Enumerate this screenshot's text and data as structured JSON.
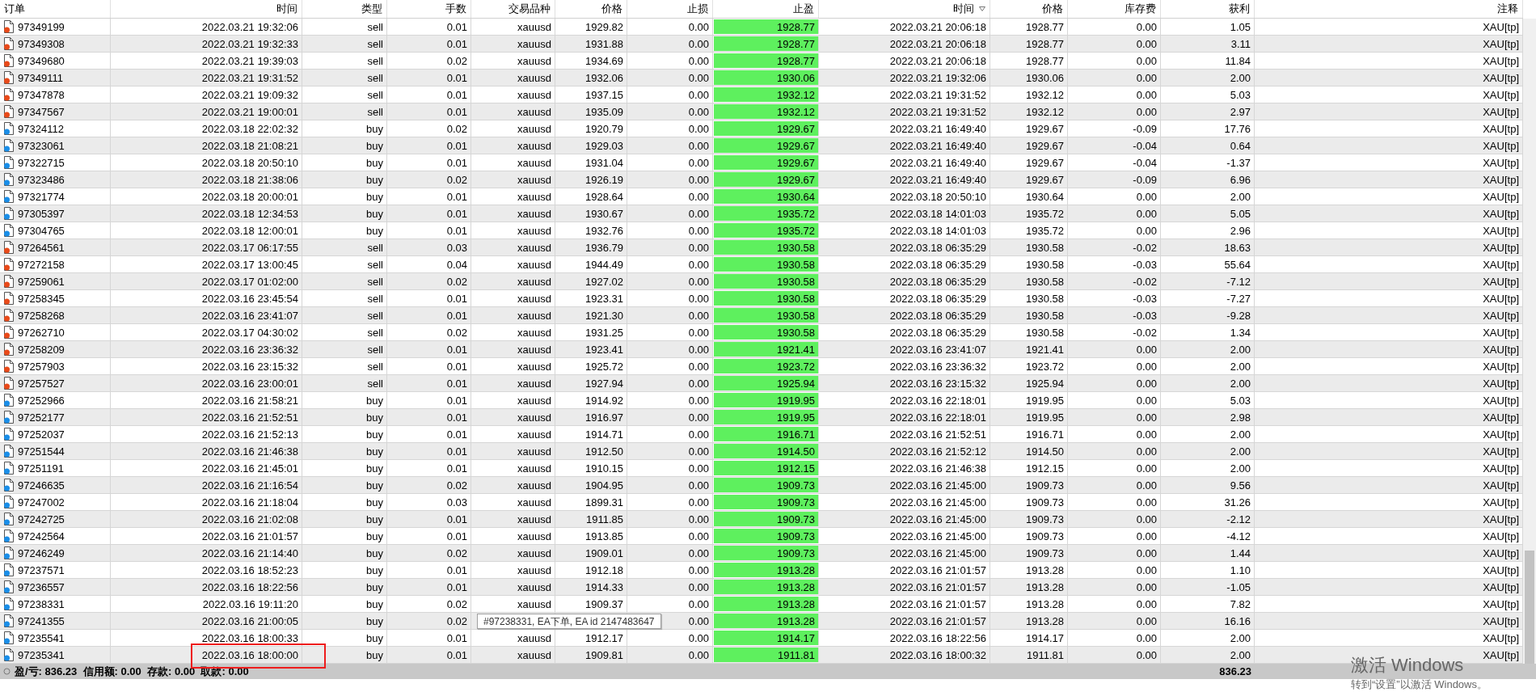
{
  "table": {
    "columns": [
      {
        "label": "订单"
      },
      {
        "label": "时间"
      },
      {
        "label": "类型"
      },
      {
        "label": "手数"
      },
      {
        "label": "交易品种"
      },
      {
        "label": "价格"
      },
      {
        "label": "止损"
      },
      {
        "label": "止盈"
      },
      {
        "label": "时间",
        "sorted": true
      },
      {
        "label": "价格"
      },
      {
        "label": "库存费"
      },
      {
        "label": "获利"
      },
      {
        "label": "注释"
      }
    ],
    "rows": [
      {
        "kind": "sell",
        "ticket": "97349199",
        "open_time": "2022.03.21 19:32:06",
        "type": "sell",
        "lots": "0.01",
        "symbol": "xauusd",
        "price": "1929.82",
        "sl": "0.00",
        "tp": "1928.77",
        "close_time": "2022.03.21 20:06:18",
        "close_price": "1928.77",
        "swap": "0.00",
        "profit": "1.05",
        "comment": "XAU[tp]"
      },
      {
        "kind": "sell",
        "ticket": "97349308",
        "open_time": "2022.03.21 19:32:33",
        "type": "sell",
        "lots": "0.01",
        "symbol": "xauusd",
        "price": "1931.88",
        "sl": "0.00",
        "tp": "1928.77",
        "close_time": "2022.03.21 20:06:18",
        "close_price": "1928.77",
        "swap": "0.00",
        "profit": "3.11",
        "comment": "XAU[tp]"
      },
      {
        "kind": "sell",
        "ticket": "97349680",
        "open_time": "2022.03.21 19:39:03",
        "type": "sell",
        "lots": "0.02",
        "symbol": "xauusd",
        "price": "1934.69",
        "sl": "0.00",
        "tp": "1928.77",
        "close_time": "2022.03.21 20:06:18",
        "close_price": "1928.77",
        "swap": "0.00",
        "profit": "11.84",
        "comment": "XAU[tp]"
      },
      {
        "kind": "sell",
        "ticket": "97349111",
        "open_time": "2022.03.21 19:31:52",
        "type": "sell",
        "lots": "0.01",
        "symbol": "xauusd",
        "price": "1932.06",
        "sl": "0.00",
        "tp": "1930.06",
        "close_time": "2022.03.21 19:32:06",
        "close_price": "1930.06",
        "swap": "0.00",
        "profit": "2.00",
        "comment": "XAU[tp]"
      },
      {
        "kind": "sell",
        "ticket": "97347878",
        "open_time": "2022.03.21 19:09:32",
        "type": "sell",
        "lots": "0.01",
        "symbol": "xauusd",
        "price": "1937.15",
        "sl": "0.00",
        "tp": "1932.12",
        "close_time": "2022.03.21 19:31:52",
        "close_price": "1932.12",
        "swap": "0.00",
        "profit": "5.03",
        "comment": "XAU[tp]"
      },
      {
        "kind": "sell",
        "ticket": "97347567",
        "open_time": "2022.03.21 19:00:01",
        "type": "sell",
        "lots": "0.01",
        "symbol": "xauusd",
        "price": "1935.09",
        "sl": "0.00",
        "tp": "1932.12",
        "close_time": "2022.03.21 19:31:52",
        "close_price": "1932.12",
        "swap": "0.00",
        "profit": "2.97",
        "comment": "XAU[tp]"
      },
      {
        "kind": "buy",
        "ticket": "97324112",
        "open_time": "2022.03.18 22:02:32",
        "type": "buy",
        "lots": "0.02",
        "symbol": "xauusd",
        "price": "1920.79",
        "sl": "0.00",
        "tp": "1929.67",
        "close_time": "2022.03.21 16:49:40",
        "close_price": "1929.67",
        "swap": "-0.09",
        "profit": "17.76",
        "comment": "XAU[tp]"
      },
      {
        "kind": "buy",
        "ticket": "97323061",
        "open_time": "2022.03.18 21:08:21",
        "type": "buy",
        "lots": "0.01",
        "symbol": "xauusd",
        "price": "1929.03",
        "sl": "0.00",
        "tp": "1929.67",
        "close_time": "2022.03.21 16:49:40",
        "close_price": "1929.67",
        "swap": "-0.04",
        "profit": "0.64",
        "comment": "XAU[tp]"
      },
      {
        "kind": "buy",
        "ticket": "97322715",
        "open_time": "2022.03.18 20:50:10",
        "type": "buy",
        "lots": "0.01",
        "symbol": "xauusd",
        "price": "1931.04",
        "sl": "0.00",
        "tp": "1929.67",
        "close_time": "2022.03.21 16:49:40",
        "close_price": "1929.67",
        "swap": "-0.04",
        "profit": "-1.37",
        "comment": "XAU[tp]"
      },
      {
        "kind": "buy",
        "ticket": "97323486",
        "open_time": "2022.03.18 21:38:06",
        "type": "buy",
        "lots": "0.02",
        "symbol": "xauusd",
        "price": "1926.19",
        "sl": "0.00",
        "tp": "1929.67",
        "close_time": "2022.03.21 16:49:40",
        "close_price": "1929.67",
        "swap": "-0.09",
        "profit": "6.96",
        "comment": "XAU[tp]"
      },
      {
        "kind": "buy",
        "ticket": "97321774",
        "open_time": "2022.03.18 20:00:01",
        "type": "buy",
        "lots": "0.01",
        "symbol": "xauusd",
        "price": "1928.64",
        "sl": "0.00",
        "tp": "1930.64",
        "close_time": "2022.03.18 20:50:10",
        "close_price": "1930.64",
        "swap": "0.00",
        "profit": "2.00",
        "comment": "XAU[tp]"
      },
      {
        "kind": "buy",
        "ticket": "97305397",
        "open_time": "2022.03.18 12:34:53",
        "type": "buy",
        "lots": "0.01",
        "symbol": "xauusd",
        "price": "1930.67",
        "sl": "0.00",
        "tp": "1935.72",
        "close_time": "2022.03.18 14:01:03",
        "close_price": "1935.72",
        "swap": "0.00",
        "profit": "5.05",
        "comment": "XAU[tp]"
      },
      {
        "kind": "buy",
        "ticket": "97304765",
        "open_time": "2022.03.18 12:00:01",
        "type": "buy",
        "lots": "0.01",
        "symbol": "xauusd",
        "price": "1932.76",
        "sl": "0.00",
        "tp": "1935.72",
        "close_time": "2022.03.18 14:01:03",
        "close_price": "1935.72",
        "swap": "0.00",
        "profit": "2.96",
        "comment": "XAU[tp]"
      },
      {
        "kind": "sell",
        "ticket": "97264561",
        "open_time": "2022.03.17 06:17:55",
        "type": "sell",
        "lots": "0.03",
        "symbol": "xauusd",
        "price": "1936.79",
        "sl": "0.00",
        "tp": "1930.58",
        "close_time": "2022.03.18 06:35:29",
        "close_price": "1930.58",
        "swap": "-0.02",
        "profit": "18.63",
        "comment": "XAU[tp]"
      },
      {
        "kind": "sell",
        "ticket": "97272158",
        "open_time": "2022.03.17 13:00:45",
        "type": "sell",
        "lots": "0.04",
        "symbol": "xauusd",
        "price": "1944.49",
        "sl": "0.00",
        "tp": "1930.58",
        "close_time": "2022.03.18 06:35:29",
        "close_price": "1930.58",
        "swap": "-0.03",
        "profit": "55.64",
        "comment": "XAU[tp]"
      },
      {
        "kind": "sell",
        "ticket": "97259061",
        "open_time": "2022.03.17 01:02:00",
        "type": "sell",
        "lots": "0.02",
        "symbol": "xauusd",
        "price": "1927.02",
        "sl": "0.00",
        "tp": "1930.58",
        "close_time": "2022.03.18 06:35:29",
        "close_price": "1930.58",
        "swap": "-0.02",
        "profit": "-7.12",
        "comment": "XAU[tp]"
      },
      {
        "kind": "sell",
        "ticket": "97258345",
        "open_time": "2022.03.16 23:45:54",
        "type": "sell",
        "lots": "0.01",
        "symbol": "xauusd",
        "price": "1923.31",
        "sl": "0.00",
        "tp": "1930.58",
        "close_time": "2022.03.18 06:35:29",
        "close_price": "1930.58",
        "swap": "-0.03",
        "profit": "-7.27",
        "comment": "XAU[tp]"
      },
      {
        "kind": "sell",
        "ticket": "97258268",
        "open_time": "2022.03.16 23:41:07",
        "type": "sell",
        "lots": "0.01",
        "symbol": "xauusd",
        "price": "1921.30",
        "sl": "0.00",
        "tp": "1930.58",
        "close_time": "2022.03.18 06:35:29",
        "close_price": "1930.58",
        "swap": "-0.03",
        "profit": "-9.28",
        "comment": "XAU[tp]"
      },
      {
        "kind": "sell",
        "ticket": "97262710",
        "open_time": "2022.03.17 04:30:02",
        "type": "sell",
        "lots": "0.02",
        "symbol": "xauusd",
        "price": "1931.25",
        "sl": "0.00",
        "tp": "1930.58",
        "close_time": "2022.03.18 06:35:29",
        "close_price": "1930.58",
        "swap": "-0.02",
        "profit": "1.34",
        "comment": "XAU[tp]"
      },
      {
        "kind": "sell",
        "ticket": "97258209",
        "open_time": "2022.03.16 23:36:32",
        "type": "sell",
        "lots": "0.01",
        "symbol": "xauusd",
        "price": "1923.41",
        "sl": "0.00",
        "tp": "1921.41",
        "close_time": "2022.03.16 23:41:07",
        "close_price": "1921.41",
        "swap": "0.00",
        "profit": "2.00",
        "comment": "XAU[tp]"
      },
      {
        "kind": "sell",
        "ticket": "97257903",
        "open_time": "2022.03.16 23:15:32",
        "type": "sell",
        "lots": "0.01",
        "symbol": "xauusd",
        "price": "1925.72",
        "sl": "0.00",
        "tp": "1923.72",
        "close_time": "2022.03.16 23:36:32",
        "close_price": "1923.72",
        "swap": "0.00",
        "profit": "2.00",
        "comment": "XAU[tp]"
      },
      {
        "kind": "sell",
        "ticket": "97257527",
        "open_time": "2022.03.16 23:00:01",
        "type": "sell",
        "lots": "0.01",
        "symbol": "xauusd",
        "price": "1927.94",
        "sl": "0.00",
        "tp": "1925.94",
        "close_time": "2022.03.16 23:15:32",
        "close_price": "1925.94",
        "swap": "0.00",
        "profit": "2.00",
        "comment": "XAU[tp]"
      },
      {
        "kind": "buy",
        "ticket": "97252966",
        "open_time": "2022.03.16 21:58:21",
        "type": "buy",
        "lots": "0.01",
        "symbol": "xauusd",
        "price": "1914.92",
        "sl": "0.00",
        "tp": "1919.95",
        "close_time": "2022.03.16 22:18:01",
        "close_price": "1919.95",
        "swap": "0.00",
        "profit": "5.03",
        "comment": "XAU[tp]"
      },
      {
        "kind": "buy",
        "ticket": "97252177",
        "open_time": "2022.03.16 21:52:51",
        "type": "buy",
        "lots": "0.01",
        "symbol": "xauusd",
        "price": "1916.97",
        "sl": "0.00",
        "tp": "1919.95",
        "close_time": "2022.03.16 22:18:01",
        "close_price": "1919.95",
        "swap": "0.00",
        "profit": "2.98",
        "comment": "XAU[tp]"
      },
      {
        "kind": "buy",
        "ticket": "97252037",
        "open_time": "2022.03.16 21:52:13",
        "type": "buy",
        "lots": "0.01",
        "symbol": "xauusd",
        "price": "1914.71",
        "sl": "0.00",
        "tp": "1916.71",
        "close_time": "2022.03.16 21:52:51",
        "close_price": "1916.71",
        "swap": "0.00",
        "profit": "2.00",
        "comment": "XAU[tp]"
      },
      {
        "kind": "buy",
        "ticket": "97251544",
        "open_time": "2022.03.16 21:46:38",
        "type": "buy",
        "lots": "0.01",
        "symbol": "xauusd",
        "price": "1912.50",
        "sl": "0.00",
        "tp": "1914.50",
        "close_time": "2022.03.16 21:52:12",
        "close_price": "1914.50",
        "swap": "0.00",
        "profit": "2.00",
        "comment": "XAU[tp]"
      },
      {
        "kind": "buy",
        "ticket": "97251191",
        "open_time": "2022.03.16 21:45:01",
        "type": "buy",
        "lots": "0.01",
        "symbol": "xauusd",
        "price": "1910.15",
        "sl": "0.00",
        "tp": "1912.15",
        "close_time": "2022.03.16 21:46:38",
        "close_price": "1912.15",
        "swap": "0.00",
        "profit": "2.00",
        "comment": "XAU[tp]"
      },
      {
        "kind": "buy",
        "ticket": "97246635",
        "open_time": "2022.03.16 21:16:54",
        "type": "buy",
        "lots": "0.02",
        "symbol": "xauusd",
        "price": "1904.95",
        "sl": "0.00",
        "tp": "1909.73",
        "close_time": "2022.03.16 21:45:00",
        "close_price": "1909.73",
        "swap": "0.00",
        "profit": "9.56",
        "comment": "XAU[tp]"
      },
      {
        "kind": "buy",
        "ticket": "97247002",
        "open_time": "2022.03.16 21:18:04",
        "type": "buy",
        "lots": "0.03",
        "symbol": "xauusd",
        "price": "1899.31",
        "sl": "0.00",
        "tp": "1909.73",
        "close_time": "2022.03.16 21:45:00",
        "close_price": "1909.73",
        "swap": "0.00",
        "profit": "31.26",
        "comment": "XAU[tp]"
      },
      {
        "kind": "buy",
        "ticket": "97242725",
        "open_time": "2022.03.16 21:02:08",
        "type": "buy",
        "lots": "0.01",
        "symbol": "xauusd",
        "price": "1911.85",
        "sl": "0.00",
        "tp": "1909.73",
        "close_time": "2022.03.16 21:45:00",
        "close_price": "1909.73",
        "swap": "0.00",
        "profit": "-2.12",
        "comment": "XAU[tp]"
      },
      {
        "kind": "buy",
        "ticket": "97242564",
        "open_time": "2022.03.16 21:01:57",
        "type": "buy",
        "lots": "0.01",
        "symbol": "xauusd",
        "price": "1913.85",
        "sl": "0.00",
        "tp": "1909.73",
        "close_time": "2022.03.16 21:45:00",
        "close_price": "1909.73",
        "swap": "0.00",
        "profit": "-4.12",
        "comment": "XAU[tp]"
      },
      {
        "kind": "buy",
        "ticket": "97246249",
        "open_time": "2022.03.16 21:14:40",
        "type": "buy",
        "lots": "0.02",
        "symbol": "xauusd",
        "price": "1909.01",
        "sl": "0.00",
        "tp": "1909.73",
        "close_time": "2022.03.16 21:45:00",
        "close_price": "1909.73",
        "swap": "0.00",
        "profit": "1.44",
        "comment": "XAU[tp]"
      },
      {
        "kind": "buy",
        "ticket": "97237571",
        "open_time": "2022.03.16 18:52:23",
        "type": "buy",
        "lots": "0.01",
        "symbol": "xauusd",
        "price": "1912.18",
        "sl": "0.00",
        "tp": "1913.28",
        "close_time": "2022.03.16 21:01:57",
        "close_price": "1913.28",
        "swap": "0.00",
        "profit": "1.10",
        "comment": "XAU[tp]"
      },
      {
        "kind": "buy",
        "ticket": "97236557",
        "open_time": "2022.03.16 18:22:56",
        "type": "buy",
        "lots": "0.01",
        "symbol": "xauusd",
        "price": "1914.33",
        "sl": "0.00",
        "tp": "1913.28",
        "close_time": "2022.03.16 21:01:57",
        "close_price": "1913.28",
        "swap": "0.00",
        "profit": "-1.05",
        "comment": "XAU[tp]"
      },
      {
        "kind": "buy",
        "ticket": "97238331",
        "open_time": "2022.03.16 19:11:20",
        "type": "buy",
        "lots": "0.02",
        "symbol": "xauusd",
        "price": "1909.37",
        "sl": "0.00",
        "tp": "1913.28",
        "close_time": "2022.03.16 21:01:57",
        "close_price": "1913.28",
        "swap": "0.00",
        "profit": "7.82",
        "comment": "XAU[tp]"
      },
      {
        "kind": "buy",
        "ticket": "97241355",
        "open_time": "2022.03.16 21:00:05",
        "type": "buy",
        "lots": "0.02",
        "sl": "0.00",
        "tp": "1913.28",
        "close_time": "2022.03.16 21:01:57",
        "close_price": "1913.28",
        "swap": "0.00",
        "profit": "16.16",
        "comment": "XAU[tp]",
        "tooltip": "#97238331, EA下单, EA id 2147483647"
      },
      {
        "kind": "buy",
        "ticket": "97235541",
        "open_time": "2022.03.16 18:00:33",
        "type": "buy",
        "lots": "0.01",
        "symbol": "xauusd",
        "price": "1912.17",
        "sl": "0.00",
        "tp": "1914.17",
        "close_time": "2022.03.16 18:22:56",
        "close_price": "1914.17",
        "swap": "0.00",
        "profit": "2.00",
        "comment": "XAU[tp]"
      },
      {
        "kind": "buy",
        "ticket": "97235341",
        "open_time": "2022.03.16 18:00:00",
        "type": "buy",
        "lots": "0.01",
        "symbol": "xauusd",
        "price": "1909.81",
        "sl": "0.00",
        "tp": "1911.81",
        "close_time": "2022.03.16 18:00:32",
        "close_price": "1911.81",
        "swap": "0.00",
        "profit": "2.00",
        "comment": "XAU[tp]",
        "highlighted": true
      }
    ]
  },
  "status_bar": {
    "summary": "盈/亏: 836.23  信用额: 0.00  存款: 0.00  取款: 0.00",
    "total": "836.23"
  },
  "activation_notice": {
    "title": "激活 Windows",
    "hint": "转到“设置”以激活 Windows。"
  }
}
